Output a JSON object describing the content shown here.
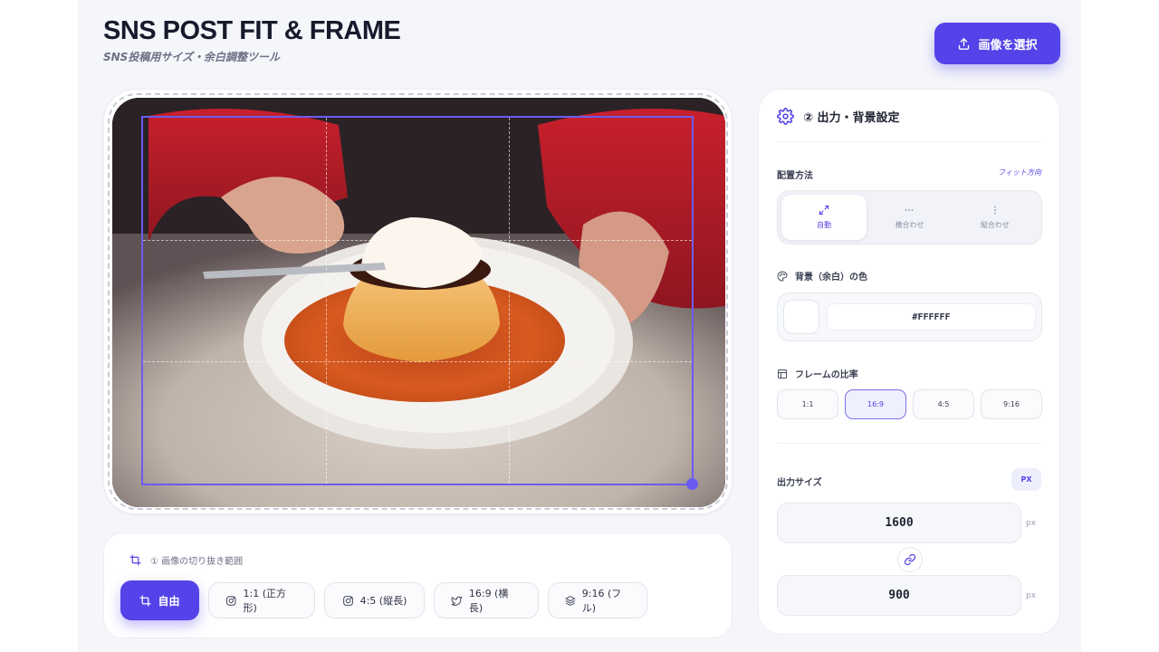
{
  "header": {
    "title": "SNS POST FIT & FRAME",
    "subtitle": "SNS投稿用サイズ・余白調整ツール",
    "select_button_label": "画像を選択"
  },
  "colors": {
    "accent": "#5443e8",
    "background": "#f5f6fa"
  },
  "crop": {
    "heading": "① 画像の切り抜き範囲",
    "presets": [
      {
        "label": "自由",
        "icon": "crop-icon",
        "active": true
      },
      {
        "label": "1:1 (正方形)",
        "icon": "instagram-icon",
        "active": false
      },
      {
        "label": "4:5 (縦長)",
        "icon": "instagram-icon",
        "active": false
      },
      {
        "label": "16:9 (横長)",
        "icon": "twitter-icon",
        "active": false
      },
      {
        "label": "9:16 (フル)",
        "icon": "layers-icon",
        "active": false
      }
    ]
  },
  "settings": {
    "title": "② 出力・背景設定",
    "placement": {
      "label": "配置方法",
      "hint": "フィット方向",
      "options": [
        {
          "label": "自動",
          "icon": "expand-icon",
          "active": true
        },
        {
          "label": "横合わせ",
          "icon": "horizontal-dots-icon",
          "active": false
        },
        {
          "label": "縦合わせ",
          "icon": "vertical-dots-icon",
          "active": false
        }
      ]
    },
    "background": {
      "label": "背景（余白）の色",
      "hex": "#FFFFFF"
    },
    "ratio": {
      "label": "フレームの比率",
      "options": [
        {
          "label": "1:1",
          "active": false
        },
        {
          "label": "16:9",
          "active": true
        },
        {
          "label": "4:5",
          "active": false
        },
        {
          "label": "9:16",
          "active": false
        }
      ]
    },
    "output": {
      "label": "出力サイズ",
      "unit_badge": "PX",
      "width": "1600",
      "height": "900",
      "unit": "px"
    }
  }
}
